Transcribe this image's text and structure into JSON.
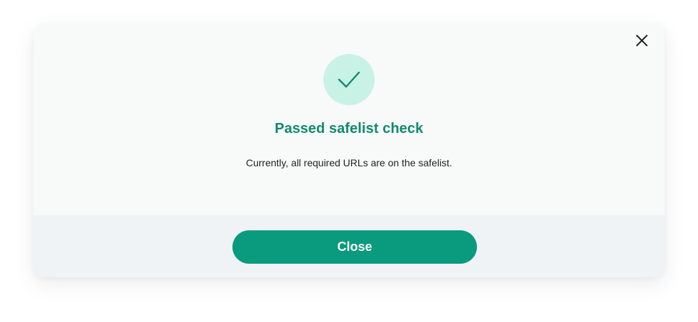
{
  "dialog": {
    "title": "Passed safelist check",
    "message": "Currently, all required URLs are on the safelist.",
    "close_button_label": "Close",
    "close_icon": "close-icon",
    "status_icon": "checkmark-icon"
  },
  "colors": {
    "accent": "#0a9a7d",
    "title": "#0e8a6e",
    "status_circle": "#c8f2e5",
    "footer_background": "#eff3f6"
  }
}
